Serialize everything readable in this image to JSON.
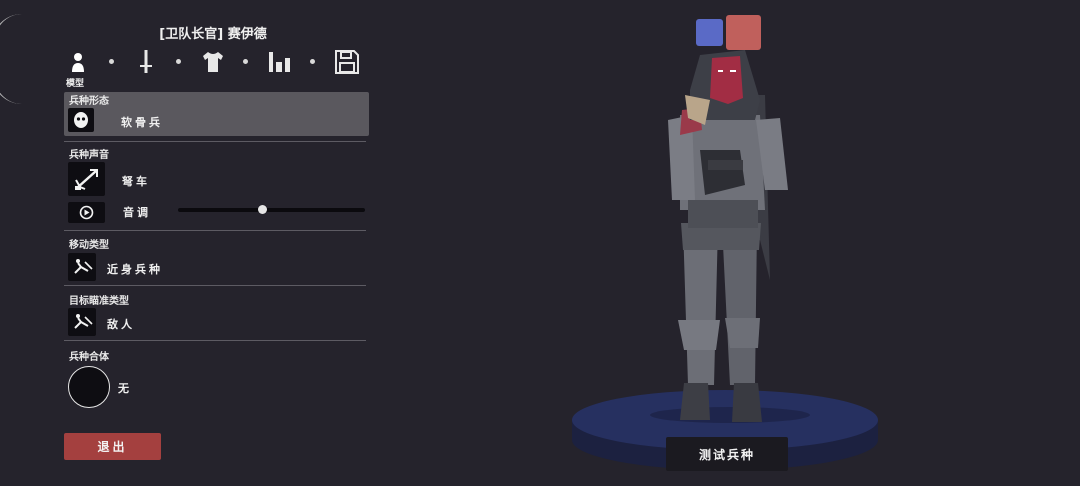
{
  "unit_title": "[卫队长官] 赛伊德",
  "tabs": [
    {
      "id": "model",
      "icon": "person-icon",
      "label": "模型",
      "active": true
    },
    {
      "id": "weapon",
      "icon": "sword-icon"
    },
    {
      "id": "clothing",
      "icon": "shirt-icon"
    },
    {
      "id": "stats",
      "icon": "bar-chart-icon"
    },
    {
      "id": "save",
      "icon": "floppy-disk-icon"
    }
  ],
  "sections": {
    "form": {
      "header": "兵种形态",
      "option": {
        "icon": "skull-mask-icon",
        "label": "软骨兵"
      }
    },
    "voice": {
      "header": "兵种声音",
      "option": {
        "icon": "ballista-icon",
        "label": "弩车"
      },
      "pitch_label": "音调",
      "pitch_value": 0.45,
      "play_icon": "play-icon"
    },
    "movement": {
      "header": "移动类型",
      "option": {
        "icon": "melee-unit-icon",
        "label": "近身兵种"
      }
    },
    "targeting": {
      "header": "目标瞄准类型",
      "option": {
        "icon": "target-enemy-icon",
        "label": "敌人"
      }
    },
    "fusion": {
      "header": "兵种合体",
      "option": {
        "icon": "empty-circle-icon",
        "label": "无"
      }
    }
  },
  "exit_label": "退出",
  "test_label": "测试兵种",
  "team_colors": {
    "blue": "#5a6ac6",
    "red": "#c0605c"
  },
  "accent": {
    "exit": "#a4403f"
  }
}
